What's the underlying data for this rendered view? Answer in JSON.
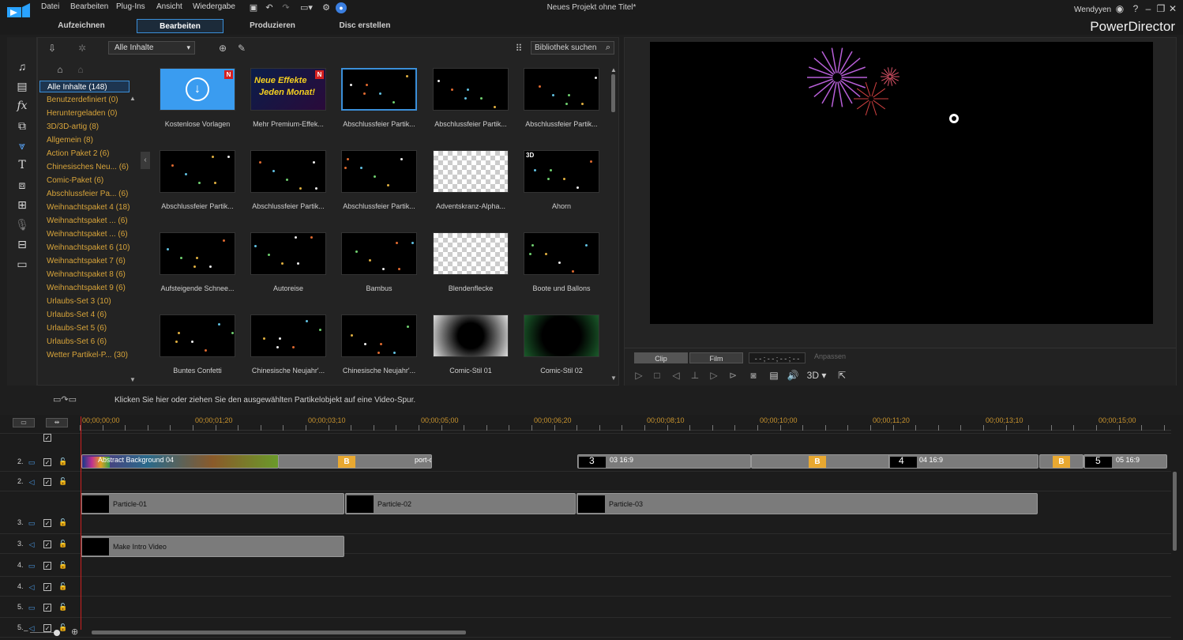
{
  "menu": [
    "Datei",
    "Bearbeiten",
    "Plug-Ins",
    "Ansicht",
    "Wiedergabe"
  ],
  "window_title": "Neues Projekt ohne Titel*",
  "user": "Wendyyen",
  "mode_tabs": [
    "Aufzeichnen",
    "Bearbeiten",
    "Produzieren",
    "Disc erstellen"
  ],
  "brand": "PowerDirector",
  "library": {
    "filter_value": "Alle Inhalte",
    "search_placeholder": "Bibliothek suchen",
    "categories": [
      "Alle Inhalte (148)",
      "Benutzerdefiniert  (0)",
      "Heruntergeladen  (0)",
      "3D/3D-artig  (8)",
      "Allgemein  (8)",
      "Action Paket 2  (6)",
      "Chinesisches Neu...  (6)",
      "Comic-Paket  (6)",
      "Abschlussfeier Pa...  (6)",
      "Weihnachtspaket 4  (18)",
      "Weihnachtspaket ...  (6)",
      "Weihnachtspaket ...  (6)",
      "Weihnachtspaket 6  (10)",
      "Weihnachtspaket 7  (6)",
      "Weihnachtspaket 8  (6)",
      "Weihnachtspaket 9  (6)",
      "Urlaubs-Set 3  (10)",
      "Urlaubs-Set 4  (6)",
      "Urlaubs-Set 5  (6)",
      "Urlaubs-Set 6  (6)",
      "Wetter Partikel-P...  (30)"
    ],
    "items": [
      {
        "label": "Kostenlose Vorlagen",
        "badge": "N"
      },
      {
        "label": "Mehr Premium-Effek...",
        "badge": "N",
        "overlay_line1": "Neue Effekte",
        "overlay_line2": "Jeden Monat!"
      },
      {
        "label": "Abschlussfeier Partik..."
      },
      {
        "label": "Abschlussfeier Partik..."
      },
      {
        "label": "Abschlussfeier Partik..."
      },
      {
        "label": "Abschlussfeier Partik..."
      },
      {
        "label": "Abschlussfeier Partik..."
      },
      {
        "label": "Abschlussfeier Partik..."
      },
      {
        "label": "Adventskranz-Alpha..."
      },
      {
        "label": "Ahorn",
        "badge3d": "3D"
      },
      {
        "label": "Aufsteigende Schnee..."
      },
      {
        "label": "Autoreise"
      },
      {
        "label": "Bambus"
      },
      {
        "label": "Blendenflecke"
      },
      {
        "label": "Boote und Ballons"
      },
      {
        "label": "Buntes Confetti"
      },
      {
        "label": "Chinesische Neujahr'..."
      },
      {
        "label": "Chinesische Neujahr'..."
      },
      {
        "label": "Comic-Stil 01"
      },
      {
        "label": "Comic-Stil 02"
      }
    ]
  },
  "preview": {
    "clip_label": "Clip",
    "film_label": "Film",
    "timecode": "- - ; - - ; - - ; - -",
    "fit_label": "Anpassen",
    "mode_3d": "3D"
  },
  "hint": "Klicken Sie hier oder ziehen Sie den ausgewählten Partikelobjekt auf eine Video-Spur.",
  "timeline": {
    "ruler": [
      "00;00;00;00",
      "00;00;01;20",
      "00;00;03;10",
      "00;00;05;00",
      "00;00;06;20",
      "00;00;08;10",
      "00;00;10;00",
      "00;00;11;20",
      "00;00;13;10",
      "00;00;15;00"
    ],
    "tracks": [
      {
        "num": "2.",
        "type": "video"
      },
      {
        "num": "2.",
        "type": "audio"
      },
      {
        "num": "3.",
        "type": "video"
      },
      {
        "num": "3.",
        "type": "audio"
      },
      {
        "num": "4.",
        "type": "video"
      },
      {
        "num": "4.",
        "type": "audio"
      },
      {
        "num": "5.",
        "type": "video"
      },
      {
        "num": "5.",
        "type": "audio"
      }
    ],
    "main_clips": {
      "c1": "Abstract Background 04",
      "c2": "port-c",
      "c3_num": "3",
      "c3_label": "03 16:9",
      "c4_num": "4",
      "c4_label": "04 16:9",
      "c5_num": "5",
      "c5_label": "05 16:9"
    },
    "particle_clips": [
      "Particle-01",
      "Particle-02",
      "Particle-03"
    ],
    "title_clip": "Make Intro Video"
  },
  "colors": {
    "accent": "#3b8fd9",
    "category_text": "#d8a43a",
    "playhead": "#d02020",
    "badge": "#d62020"
  }
}
